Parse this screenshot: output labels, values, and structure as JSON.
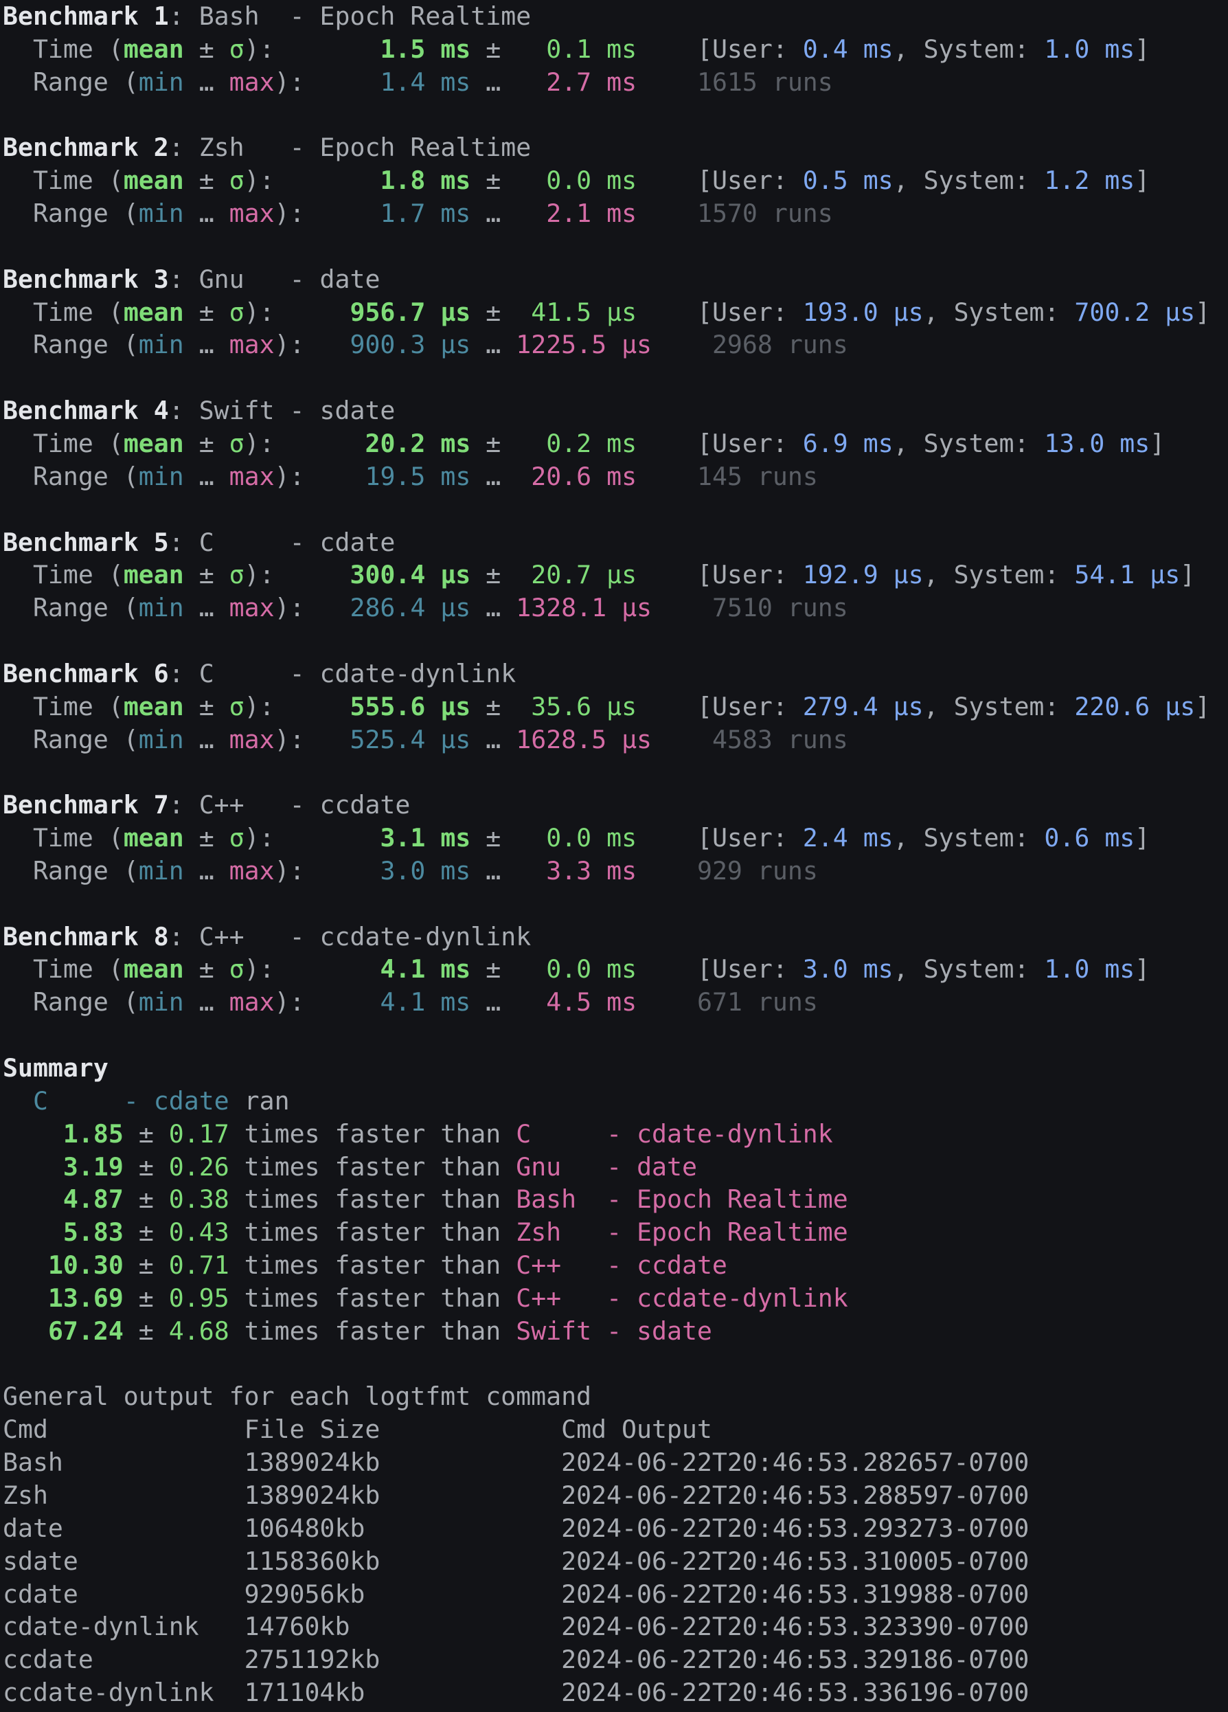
{
  "labels": {
    "benchmark": "Benchmark",
    "time": "Time",
    "mean": "mean",
    "pm": "±",
    "sigma": "σ",
    "range": "Range",
    "min": "min",
    "ellipsis": "…",
    "max": "max",
    "user": "User",
    "system": "System",
    "runs": "runs",
    "summary": "Summary",
    "ran": "ran",
    "faster": "times faster than",
    "general": "General output for each logtfmt command"
  },
  "benchmarks": [
    {
      "n": "1",
      "name": "Bash",
      "cmd": "Epoch Realtime",
      "mean": "1.5 ms",
      "sd": "0.1 ms",
      "user": "0.4 ms",
      "system": "1.0 ms",
      "min": "1.4 ms",
      "max": "2.7 ms",
      "runs": "1615"
    },
    {
      "n": "2",
      "name": "Zsh",
      "cmd": "Epoch Realtime",
      "mean": "1.8 ms",
      "sd": "0.0 ms",
      "user": "0.5 ms",
      "system": "1.2 ms",
      "min": "1.7 ms",
      "max": "2.1 ms",
      "runs": "1570"
    },
    {
      "n": "3",
      "name": "Gnu",
      "cmd": "date",
      "mean": "956.7 µs",
      "sd": "41.5 µs",
      "user": "193.0 µs",
      "system": "700.2 µs",
      "min": "900.3 µs",
      "max": "1225.5 µs",
      "runs": "2968"
    },
    {
      "n": "4",
      "name": "Swift",
      "cmd": "sdate",
      "mean": "20.2 ms",
      "sd": "0.2 ms",
      "user": "6.9 ms",
      "system": "13.0 ms",
      "min": "19.5 ms",
      "max": "20.6 ms",
      "runs": "145"
    },
    {
      "n": "5",
      "name": "C",
      "cmd": "cdate",
      "mean": "300.4 µs",
      "sd": "20.7 µs",
      "user": "192.9 µs",
      "system": "54.1 µs",
      "min": "286.4 µs",
      "max": "1328.1 µs",
      "runs": "7510"
    },
    {
      "n": "6",
      "name": "C",
      "cmd": "cdate-dynlink",
      "mean": "555.6 µs",
      "sd": "35.6 µs",
      "user": "279.4 µs",
      "system": "220.6 µs",
      "min": "525.4 µs",
      "max": "1628.5 µs",
      "runs": "4583"
    },
    {
      "n": "7",
      "name": "C++",
      "cmd": "ccdate",
      "mean": "3.1 ms",
      "sd": "0.0 ms",
      "user": "2.4 ms",
      "system": "0.6 ms",
      "min": "3.0 ms",
      "max": "3.3 ms",
      "runs": "929"
    },
    {
      "n": "8",
      "name": "C++",
      "cmd": "ccdate-dynlink",
      "mean": "4.1 ms",
      "sd": "0.0 ms",
      "user": "3.0 ms",
      "system": "1.0 ms",
      "min": "4.1 ms",
      "max": "4.5 ms",
      "runs": "671"
    }
  ],
  "summary": {
    "fastest": {
      "name": "C",
      "cmd": "cdate"
    },
    "rows": [
      {
        "ratio": "1.85",
        "sd": "0.17",
        "name": "C",
        "cmd": "cdate-dynlink"
      },
      {
        "ratio": "3.19",
        "sd": "0.26",
        "name": "Gnu",
        "cmd": "date"
      },
      {
        "ratio": "4.87",
        "sd": "0.38",
        "name": "Bash",
        "cmd": "Epoch Realtime"
      },
      {
        "ratio": "5.83",
        "sd": "0.43",
        "name": "Zsh",
        "cmd": "Epoch Realtime"
      },
      {
        "ratio": "10.30",
        "sd": "0.71",
        "name": "C++",
        "cmd": "ccdate"
      },
      {
        "ratio": "13.69",
        "sd": "0.95",
        "name": "C++",
        "cmd": "ccdate-dynlink"
      },
      {
        "ratio": "67.24",
        "sd": "4.68",
        "name": "Swift",
        "cmd": "sdate"
      }
    ]
  },
  "table": {
    "columns": [
      "Cmd",
      "File Size",
      "Cmd Output"
    ],
    "rows": [
      [
        "Bash",
        "1389024kb",
        "2024-06-22T20:46:53.282657-0700"
      ],
      [
        "Zsh",
        "1389024kb",
        "2024-06-22T20:46:53.288597-0700"
      ],
      [
        "date",
        "106480kb",
        "2024-06-22T20:46:53.293273-0700"
      ],
      [
        "sdate",
        "1158360kb",
        "2024-06-22T20:46:53.310005-0700"
      ],
      [
        "cdate",
        "929056kb",
        "2024-06-22T20:46:53.319988-0700"
      ],
      [
        "cdate-dynlink",
        "14760kb",
        "2024-06-22T20:46:53.323390-0700"
      ],
      [
        "ccdate",
        "2751192kb",
        "2024-06-22T20:46:53.329186-0700"
      ],
      [
        "ccdate-dynlink",
        "171104kb",
        "2024-06-22T20:46:53.336196-0700"
      ]
    ]
  }
}
